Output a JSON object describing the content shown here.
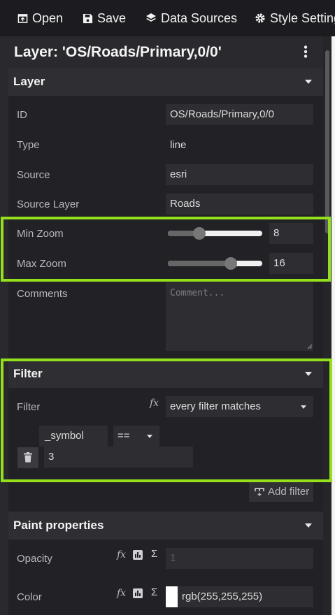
{
  "toolbar": {
    "open_label": "Open",
    "save_label": "Save",
    "data_sources_label": "Data Sources",
    "style_settings_label": "Style Settings"
  },
  "layer": {
    "title": "Layer: 'OS/Roads/Primary,0/0'"
  },
  "sections": {
    "layer": "Layer",
    "filter": "Filter",
    "paint": "Paint properties"
  },
  "fields": {
    "id_label": "ID",
    "id_value": "OS/Roads/Primary,0/0",
    "type_label": "Type",
    "type_value": "line",
    "source_label": "Source",
    "source_value": "esri",
    "source_layer_label": "Source Layer",
    "source_layer_value": "Roads",
    "min_zoom_label": "Min Zoom",
    "min_zoom_value": "8",
    "max_zoom_label": "Max Zoom",
    "max_zoom_value": "16",
    "comments_label": "Comments",
    "comments_placeholder": "Comment..."
  },
  "zoom": {
    "min": 8,
    "max": 16,
    "range_max": 24
  },
  "filter": {
    "label": "Filter",
    "mode": "every filter matches",
    "key": "_symbol",
    "op": "==",
    "value": "3",
    "add_label": "Add filter"
  },
  "paint": {
    "opacity_label": "Opacity",
    "opacity_placeholder": "1",
    "color_label": "Color",
    "color_value": "rgb(255,255,255)",
    "color_swatch": "#ffffff"
  },
  "colors": {
    "highlight": "#94e01a",
    "panel": "#2a2a2e"
  }
}
